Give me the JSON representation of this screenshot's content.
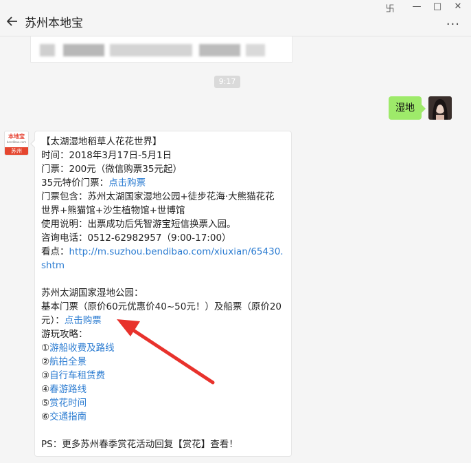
{
  "window": {
    "title": "苏州本地宝",
    "minimize": "—",
    "maximize": "□",
    "close": "✕",
    "pin": "卐",
    "more": "···"
  },
  "chat": {
    "timestamp": "9:17",
    "outgoing_message": "湿地",
    "brand_avatar": {
      "top": "本地宝",
      "middle": "bendibao.com",
      "bottom": "苏州"
    },
    "message_lines": [
      "【太湖湿地稻草人花花世界】",
      "时间：2018年3月17日-5月1日",
      "门票：200元（微信购票35元起）",
      "35元特价门票：",
      "门票包含：苏州太湖国家湿地公园+徒步花海·大熊猫花花",
      "世界+熊猫馆+沙生植物馆+世博馆",
      "使用说明：出票成功后凭智游宝短信换票入园。",
      "咨询电话：0512-62982957（9:00-17:00）",
      "看点：",
      "shtm",
      "苏州太湖国家湿地公园：",
      "基本门票（原价60元优惠价40~50元！）及船票（原价20",
      "元）：",
      "游玩攻略：",
      "①",
      "②",
      "③",
      "④",
      "⑤",
      "⑥",
      "PS：更多苏州春季赏花活动回复【赏花】查看！"
    ],
    "links": {
      "buy_ticket_1": "点击购票",
      "view_url": "http://m.suzhou.bendibao.com/xiuxian/65430.",
      "buy_ticket_2": "点击购票",
      "guide_1": "游船收费及路线",
      "guide_2": "航拍全景",
      "guide_3": "自行车租赁费",
      "guide_4": "春游路线",
      "guide_5": "赏花时间",
      "guide_6": "交通指南"
    }
  },
  "colors": {
    "bubble_out": "#9eea6a",
    "link": "#2a7bd1",
    "arrow": "#e8322c",
    "background": "#f5f5f5"
  }
}
